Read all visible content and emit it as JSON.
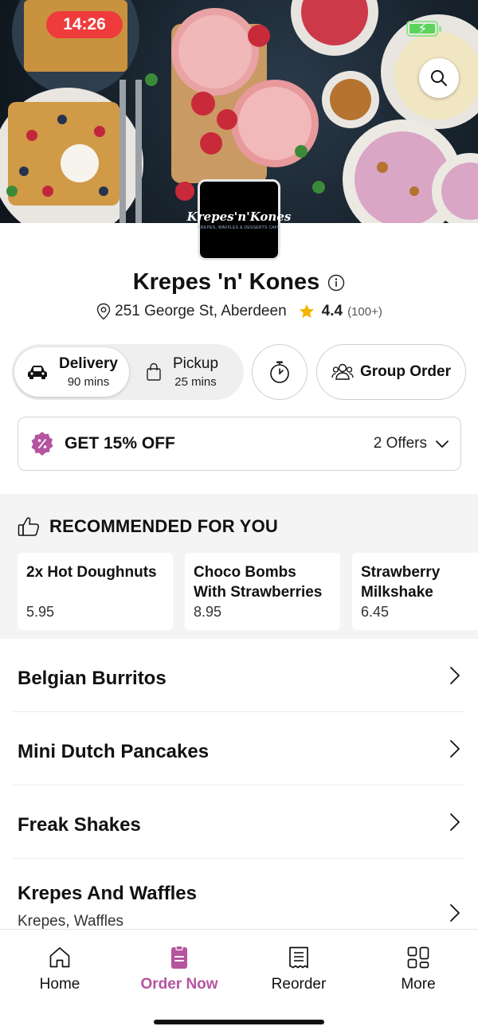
{
  "status_bar": {
    "time": "14:26"
  },
  "store": {
    "logo_text": "Krepes'n'Kones",
    "logo_tagline": "CREPES, WAFFLES & DESSERTS CAFE",
    "name": "Krepes 'n' Kones",
    "address": "251 George St, Aberdeen",
    "rating": "4.4",
    "rating_count": "(100+)"
  },
  "order_mode": {
    "delivery": {
      "label": "Delivery",
      "time": "90 mins",
      "selected": true
    },
    "pickup": {
      "label": "Pickup",
      "time": "25 mins",
      "selected": false
    },
    "group_order_label": "Group Order"
  },
  "offer": {
    "title": "GET 15% OFF",
    "count": "2 Offers"
  },
  "recommended": {
    "title": "RECOMMENDED FOR YOU",
    "items": [
      {
        "name": "2x Hot Doughnuts",
        "price": "5.95"
      },
      {
        "name": "Choco Bombs With Strawberries",
        "price": "8.95"
      },
      {
        "name": "Strawberry Milkshake",
        "price": "6.45"
      }
    ]
  },
  "categories": [
    {
      "name": "Belgian Burritos"
    },
    {
      "name": "Mini Dutch Pancakes"
    },
    {
      "name": "Freak Shakes"
    },
    {
      "name": "Krepes And Waffles",
      "subtitle": "Krepes, Waffles"
    }
  ],
  "tabs": [
    {
      "label": "Home",
      "icon": "home-icon"
    },
    {
      "label": "Order Now",
      "icon": "order-icon",
      "active": true
    },
    {
      "label": "Reorder",
      "icon": "receipt-icon"
    },
    {
      "label": "More",
      "icon": "grid-icon"
    }
  ],
  "colors": {
    "accent": "#b5549f",
    "status_time_bg": "#ef3b3b",
    "star": "#f5b400"
  }
}
